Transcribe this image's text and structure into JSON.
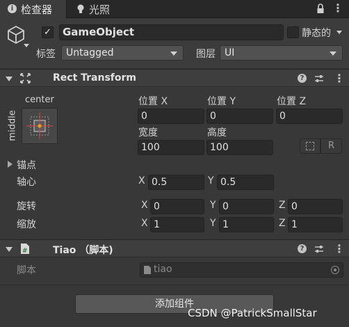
{
  "tabs": [
    {
      "label": "检查器",
      "icon": "info-icon",
      "active": true
    },
    {
      "label": "光照",
      "icon": "lightbulb-icon",
      "active": false
    }
  ],
  "gameobject": {
    "enabled": true,
    "name": "GameObject",
    "static_label": "静态的",
    "tag_label": "标签",
    "tag_value": "Untagged",
    "layer_label": "图层",
    "layer_value": "UI"
  },
  "rect_transform": {
    "title": "Rect Transform",
    "anchor_preset": {
      "horizontal": "center",
      "vertical": "middle"
    },
    "pos_x_label": "位置 X",
    "pos_y_label": "位置 Y",
    "pos_z_label": "位置 Z",
    "pos_x": "0",
    "pos_y": "0",
    "pos_z": "0",
    "width_label": "宽度",
    "height_label": "高度",
    "width": "100",
    "height": "100",
    "raw_edit_label": "R",
    "anchors_label": "锚点",
    "pivot_label": "轴心",
    "pivot_x": "0.5",
    "pivot_y": "0.5",
    "rotation_label": "旋转",
    "rotation_x": "0",
    "rotation_y": "0",
    "rotation_z": "0",
    "scale_label": "缩放",
    "scale_x": "1",
    "scale_y": "1",
    "scale_z": "1",
    "axis_x": "X",
    "axis_y": "Y",
    "axis_z": "Z"
  },
  "script_component": {
    "title": "Tiao （脚本)",
    "script_label": "脚本",
    "script_value": "tiao"
  },
  "add_component_label": "添加组件",
  "watermark": "CSDN @PatrickSmallStar",
  "colors": {
    "background": "#383838",
    "field": "#2a2a2a",
    "header": "#3e3e3e",
    "tab_bar": "#282828",
    "anchor_red": "#d04040",
    "anchor_dot": "#e0a020"
  }
}
